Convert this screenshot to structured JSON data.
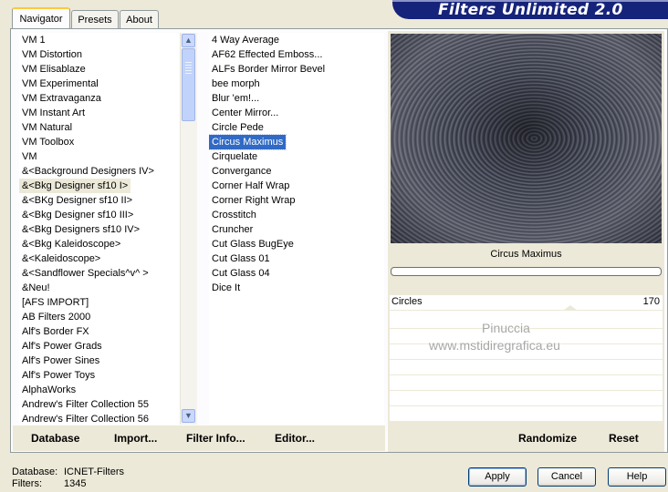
{
  "header": {
    "title": "Filters Unlimited 2.0"
  },
  "tabs": [
    {
      "label": "Navigator",
      "active": true
    },
    {
      "label": "Presets",
      "active": false
    },
    {
      "label": "About",
      "active": false
    }
  ],
  "categories": {
    "items": [
      "VM 1",
      "VM Distortion",
      "VM Elisablaze",
      "VM Experimental",
      "VM Extravaganza",
      "VM Instant Art",
      "VM Natural",
      "VM Toolbox",
      "VM",
      "&<Background Designers IV>",
      "&<Bkg Designer sf10 I>",
      "&<BKg Designer sf10 II>",
      "&<Bkg Designer sf10 III>",
      "&<Bkg Designers sf10 IV>",
      "&<Bkg Kaleidoscope>",
      "&<Kaleidoscope>",
      "&<Sandflower Specials^v^ >",
      "&Neu!",
      "[AFS IMPORT]",
      "AB Filters 2000",
      "Alf's Border FX",
      "Alf's Power Grads",
      "Alf's Power Sines",
      "Alf's Power Toys",
      "AlphaWorks",
      "Andrew's Filter Collection 55",
      "Andrew's Filter Collection 56"
    ],
    "highlighted": "&<Bkg Designer sf10 I>"
  },
  "filters": {
    "items": [
      "4 Way Average",
      "AF62 Effected Emboss...",
      "ALFs Border Mirror Bevel",
      "bee morph",
      "Blur 'em!...",
      "Center Mirror...",
      "Circle Pede",
      "Circus Maximus",
      "Cirquelate",
      "Convergance",
      "Corner Half Wrap",
      "Corner Right Wrap",
      "Crosstitch",
      "Cruncher",
      "Cut Glass  BugEye",
      "Cut Glass 01",
      "Cut Glass 04",
      "Dice It"
    ],
    "selected": "Circus Maximus"
  },
  "toolbar": {
    "database": "Database",
    "import": "Import...",
    "filter_info": "Filter Info...",
    "editor": "Editor..."
  },
  "preview": {
    "filter_name": "Circus Maximus"
  },
  "parameters": [
    {
      "label": "Circles",
      "value": "170"
    }
  ],
  "watermark": {
    "line1": "Pinuccia",
    "line2": "www.mstidiregrafica.eu"
  },
  "actions": {
    "randomize": "Randomize",
    "reset": "Reset"
  },
  "status": {
    "database_label": "Database:",
    "database_value": "ICNET-Filters",
    "filters_label": "Filters:",
    "filters_value": "1345"
  },
  "dialog_buttons": {
    "apply": "Apply",
    "cancel": "Cancel",
    "help": "Help"
  }
}
